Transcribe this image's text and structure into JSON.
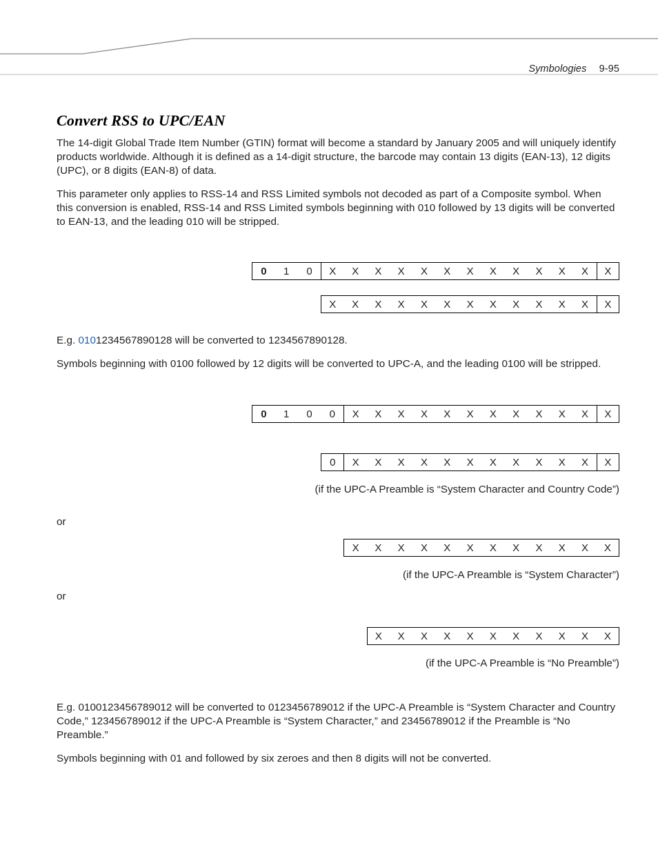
{
  "header": {
    "chapter": "Symbologies",
    "page": "9-95"
  },
  "section_title": "Convert RSS to UPC/EAN",
  "para1": "The 14-digit Global Trade Item Number (GTIN) format will become a standard by January 2005 and will uniquely identify products worldwide. Although it is defined as a 14-digit structure, the barcode may contain 13 digits (EAN-13), 12 digits (UPC), or 8 digits (EAN-8) of data.",
  "para2": "This parameter only applies to RSS-14 and RSS Limited symbols not decoded as part of a Composite symbol. When this conversion is enabled, RSS-14 and RSS Limited symbols beginning with 010 followed by 13 digits will be converted to EAN-13, and the leading 010 will be stripped.",
  "row1": [
    "0",
    "1",
    "0",
    "X",
    "X",
    "X",
    "X",
    "X",
    "X",
    "X",
    "X",
    "X",
    "X",
    "X",
    "X",
    "X"
  ],
  "row2": [
    "X",
    "X",
    "X",
    "X",
    "X",
    "X",
    "X",
    "X",
    "X",
    "X",
    "X",
    "X",
    "X"
  ],
  "eg1_pre": "E.g. ",
  "eg1_hl": "010",
  "eg1_post": "1234567890128 will be converted to 1234567890128.",
  "para3": "Symbols beginning with 0100 followed by 12 digits will be converted to UPC-A, and the leading 0100 will be stripped.",
  "row3": [
    "0",
    "1",
    "0",
    "0",
    "X",
    "X",
    "X",
    "X",
    "X",
    "X",
    "X",
    "X",
    "X",
    "X",
    "X",
    "X"
  ],
  "row4": [
    "0",
    "X",
    "X",
    "X",
    "X",
    "X",
    "X",
    "X",
    "X",
    "X",
    "X",
    "X",
    "X"
  ],
  "cap1": "(if the UPC-A Preamble is “System Character and Country Code”)",
  "or": "or",
  "row5": [
    "X",
    "X",
    "X",
    "X",
    "X",
    "X",
    "X",
    "X",
    "X",
    "X",
    "X",
    "X"
  ],
  "cap2": "(if the UPC-A Preamble is “System Character”)",
  "row6": [
    "X",
    "X",
    "X",
    "X",
    "X",
    "X",
    "X",
    "X",
    "X",
    "X",
    "X"
  ],
  "cap3": "(if the UPC-A Preamble is “No Preamble”)",
  "eg2": "E.g. 0100123456789012 will be converted to 0123456789012 if the UPC-A Preamble is “System Character and Country Code,” 123456789012 if the UPC-A Preamble is “System Character,” and 23456789012 if the Preamble is “No Preamble.”",
  "para4": "Symbols beginning with 01 and followed by six zeroes and then 8 digits will not be converted."
}
